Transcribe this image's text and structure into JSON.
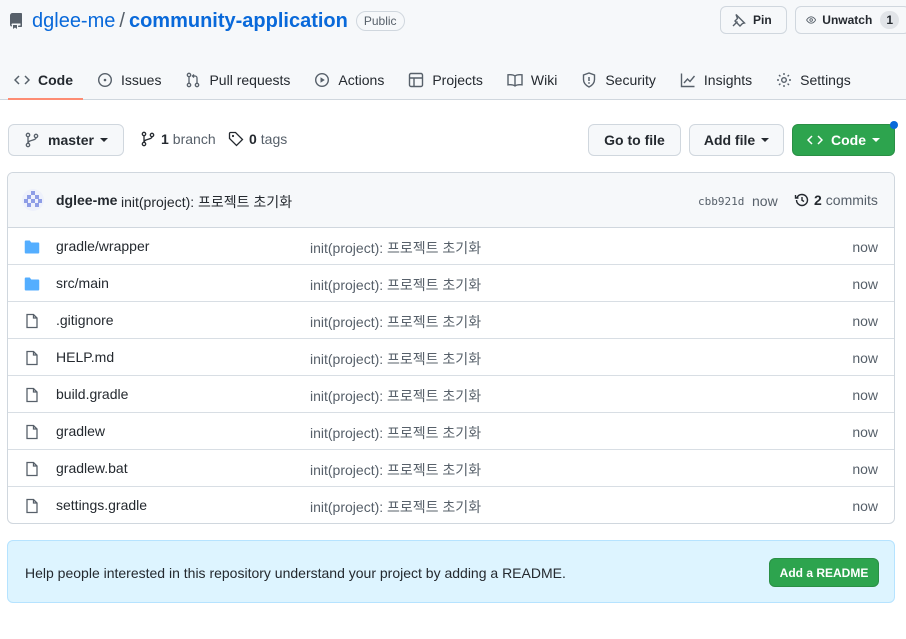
{
  "repo": {
    "owner": "dglee-me",
    "separator": "/",
    "name": "community-application",
    "visibility": "Public"
  },
  "header_actions": {
    "pin_label": "Pin",
    "watch_label": "Unwatch",
    "watch_count": "1"
  },
  "tabs": [
    {
      "label": "Code",
      "icon": "code-icon",
      "active": true
    },
    {
      "label": "Issues",
      "icon": "issue-icon"
    },
    {
      "label": "Pull requests",
      "icon": "pull-request-icon"
    },
    {
      "label": "Actions",
      "icon": "play-icon"
    },
    {
      "label": "Projects",
      "icon": "table-icon"
    },
    {
      "label": "Wiki",
      "icon": "book-icon"
    },
    {
      "label": "Security",
      "icon": "shield-icon"
    },
    {
      "label": "Insights",
      "icon": "graph-icon"
    },
    {
      "label": "Settings",
      "icon": "gear-icon"
    }
  ],
  "toolbar": {
    "branch": "master",
    "branch_count": "1",
    "branch_word": "branch",
    "tag_count": "0",
    "tag_word": "tags",
    "goto_file": "Go to file",
    "add_file": "Add file",
    "code": "Code"
  },
  "latest_commit": {
    "author": "dglee-me",
    "message": "init(project): 프로젝트 초기화",
    "sha": "cbb921d",
    "time": "now",
    "commit_count": "2",
    "commit_word": "commits"
  },
  "files": [
    {
      "name": "gradle/wrapper",
      "type": "folder",
      "message": "init(project): 프로젝트 초기화",
      "age": "now"
    },
    {
      "name": "src/main",
      "type": "folder",
      "message": "init(project): 프로젝트 초기화",
      "age": "now"
    },
    {
      "name": ".gitignore",
      "type": "file",
      "message": "init(project): 프로젝트 초기화",
      "age": "now"
    },
    {
      "name": "HELP.md",
      "type": "file",
      "message": "init(project): 프로젝트 초기화",
      "age": "now"
    },
    {
      "name": "build.gradle",
      "type": "file",
      "message": "init(project): 프로젝트 초기화",
      "age": "now"
    },
    {
      "name": "gradlew",
      "type": "file",
      "message": "init(project): 프로젝트 초기화",
      "age": "now"
    },
    {
      "name": "gradlew.bat",
      "type": "file",
      "message": "init(project): 프로젝트 초기화",
      "age": "now"
    },
    {
      "name": "settings.gradle",
      "type": "file",
      "message": "init(project): 프로젝트 초기화",
      "age": "now"
    }
  ],
  "readme": {
    "text": "Help people interested in this repository understand your project by adding a README.",
    "button": "Add a README"
  },
  "colors": {
    "link": "#0969da",
    "primary_button": "#2da44e",
    "active_tab_underline": "#fd8c73",
    "folder": "#54aeff"
  }
}
